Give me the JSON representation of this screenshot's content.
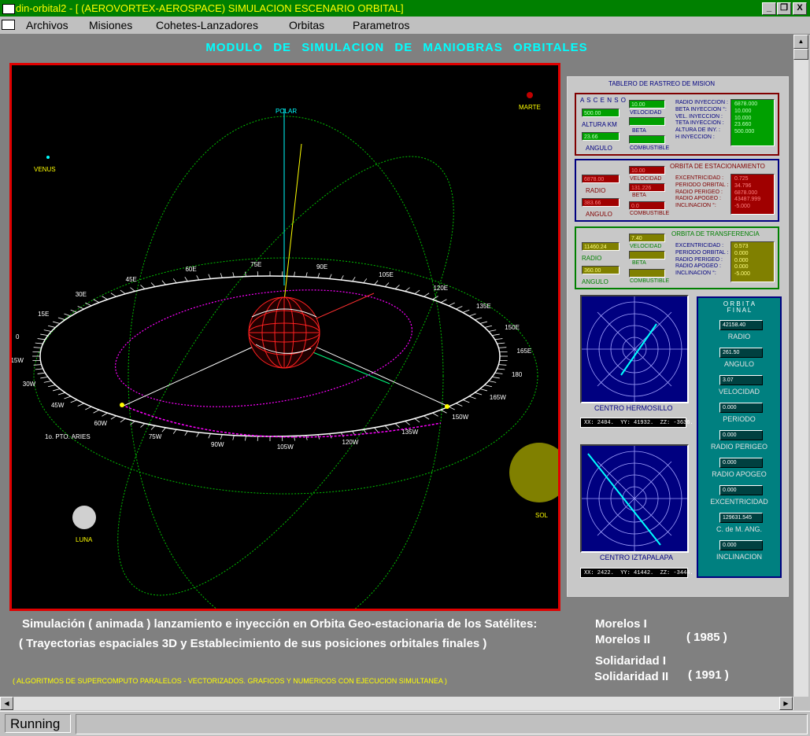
{
  "window": {
    "title": "din-orbital2 - [  (AEROVORTEX-AEROSPACE)  SIMULACION ESCENARIO ORBITAL]",
    "min_label": "_",
    "restore_label": "❐",
    "close_label": "X"
  },
  "menu": [
    "Archivos",
    "Misiones",
    "Cohetes-Lanzadores",
    "Orbitas",
    "Parametros"
  ],
  "main_title": "MODULO DE SIMULACION DE MANIOBRAS ORBITALES",
  "viewport": {
    "labels": {
      "polar": "POLAR",
      "marte": "MARTE",
      "venus": "VENUS",
      "luna": "LUNA",
      "sol": "SOL",
      "aries": "1o. PTO. ARIES"
    },
    "longitudes": [
      {
        "t": "0"
      },
      {
        "t": "15E"
      },
      {
        "t": "30E"
      },
      {
        "t": "45E"
      },
      {
        "t": "60E"
      },
      {
        "t": "75E"
      },
      {
        "t": "90E"
      },
      {
        "t": "105E"
      },
      {
        "t": "120E"
      },
      {
        "t": "135E"
      },
      {
        "t": "150E"
      },
      {
        "t": "165E"
      },
      {
        "t": "180"
      },
      {
        "t": "165W"
      },
      {
        "t": "150W"
      },
      {
        "t": "135W"
      },
      {
        "t": "120W"
      },
      {
        "t": "105W"
      },
      {
        "t": "90W"
      },
      {
        "t": "75W"
      },
      {
        "t": "60W"
      },
      {
        "t": "45W"
      },
      {
        "t": "30W"
      },
      {
        "t": "15W"
      }
    ]
  },
  "tablero": {
    "title": "TABLERO DE RASTREO DE MISION",
    "ascenso": {
      "title": "A S C E N S O",
      "altura_label": "ALTURA KM",
      "altura": "500.00",
      "angulo_label": "ANGULO",
      "angulo": "23.66",
      "velocidad_label": "VELOCIDAD",
      "velocidad": "10.00",
      "beta_label": "BETA",
      "combustible_label": "COMBUSTIBLE",
      "params_labels": "RADIO INYECCION :\nBETA INYECCION °:\nVEL. INYECCION :\nTETA INYECCION :\nALTURA DE INY. :\nH INYECCION :",
      "params_values": "6878.000\n10.000\n10.000\n23.660\n500.000"
    },
    "estacionamiento": {
      "title": "ORBITA DE ESTACIONAMIENTO",
      "radio_label": "RADIO",
      "radio": "6878.00",
      "angulo_label": "ANGULO",
      "angulo": "383.66",
      "velocidad_label": "VELOCIDAD",
      "velocidad": "10.00",
      "velocidad2": "131.226",
      "beta_label": "BETA",
      "beta": "0.0",
      "combustible_label": "COMBUSTIBLE",
      "params_labels": "EXCENTRICIDAD :\nPERIODO ORBITAL :\nRADIO PERIGEO :\nRADIO APOGEO :\nINCLINACION °:",
      "params_values": "0.725\n34.796\n6878.000\n43487.999\n-5.000"
    },
    "transferencia": {
      "title": "ORBITA  DE  TRANSFERENCIA",
      "radio_label": "RADIO",
      "radio": "11460.24",
      "angulo_label": "ANGULO",
      "angulo": "360.00",
      "velocidad_label": "VELOCIDAD",
      "velocidad": "7.40",
      "beta_label": "BETA",
      "combustible_label": "COMBUSTIBLE",
      "params_labels": "EXCENTRICIDAD :\nPERIODO ORBITAL :\nRADIO PERIGEO :\nRADIO APOGEO :\nINCLINACION °:",
      "params_values": "0.573\n0.000\n0.000\n0.000\n-5.000"
    }
  },
  "radar1": {
    "label": "CENTRO  HERMOSILLO",
    "coords": "XX: 2404.  YY: 41932.  ZZ: -3636."
  },
  "radar2": {
    "label": "CENTRO  IZTAPALAPA",
    "coords": "XX: 2422.  YY: 41442.  ZZ: -3444."
  },
  "orbita_final": {
    "title": "O R B I T A\nF I N A L",
    "items": [
      {
        "value": "42158.40",
        "label": "RADIO"
      },
      {
        "value": "261.50",
        "label": "ANGULO"
      },
      {
        "value": "3.07",
        "label": "VELOCIDAD"
      },
      {
        "value": "0.000",
        "label": "PERIODO"
      },
      {
        "value": "0.000",
        "label": "RADIO PERIGEO"
      },
      {
        "value": "0.000",
        "label": "RADIO APOGEO"
      },
      {
        "value": "0.000",
        "label": "EXCENTRICIDAD"
      },
      {
        "value": "129631.545",
        "label": "C. de M. ANG."
      },
      {
        "value": "0.000",
        "label": "INCLINACION"
      }
    ]
  },
  "description": {
    "line1": "Simulación  ( animada ) lanzamiento e inyección en Orbita Geo-estacionaria de los Satélites:",
    "line2": "( Trayectorias espaciales 3D y Establecimiento de sus posiciones orbitales finales )",
    "sat1": "Morelos I",
    "sat2": "Morelos II",
    "year1": "( 1985 )",
    "sat3": "Solidaridad I",
    "sat4": "Solidaridad II",
    "year2": "( 1991 )",
    "footnote": "( ALGORITMOS DE SUPERCOMPUTO PARALELOS - VECTORIZADOS.  GRAFICOS  Y  NUMERICOS   CON  EJECUCION  SIMULTANEA )"
  },
  "status": "Running",
  "colors": {
    "titlebar": "#008000",
    "title_text": "#ffff00",
    "accent_cyan": "#00ffff",
    "viewport_border": "#e00000"
  }
}
